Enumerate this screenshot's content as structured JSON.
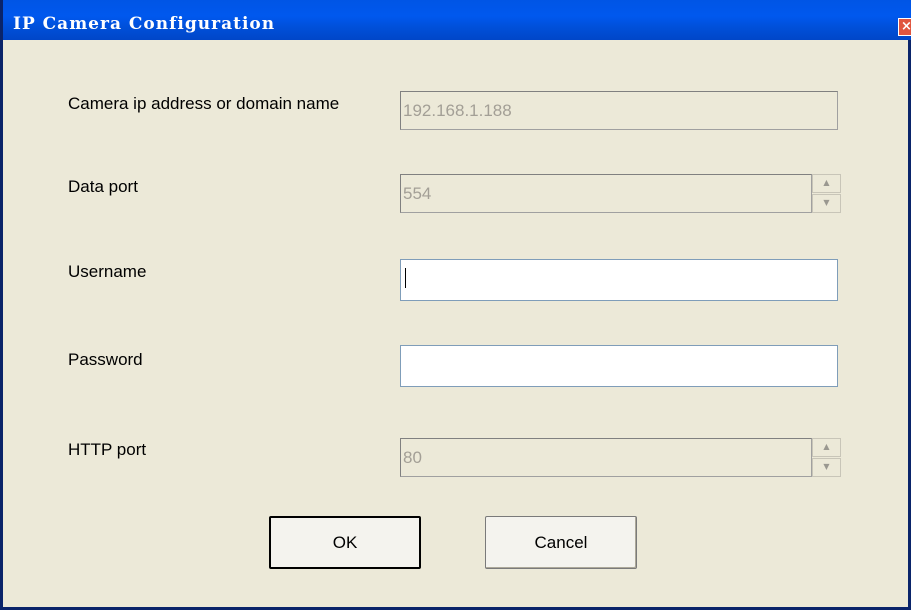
{
  "window": {
    "title": "IP Camera Configuration",
    "close_symbol": "×"
  },
  "form": {
    "ip": {
      "label": "Camera ip address or domain name",
      "value": "192.168.1.188"
    },
    "data_port": {
      "label": "Data port",
      "value": "554"
    },
    "username": {
      "label": "Username",
      "value": ""
    },
    "password": {
      "label": "Password",
      "value": ""
    },
    "http_port": {
      "label": "HTTP port",
      "value": "80"
    }
  },
  "spin": {
    "up": "▲",
    "down": "▼"
  },
  "buttons": {
    "ok": "OK",
    "cancel": "Cancel"
  },
  "colors": {
    "titlebar": "#0055E5",
    "window_bg": "#ECE9D8",
    "close": "#E0553F"
  }
}
